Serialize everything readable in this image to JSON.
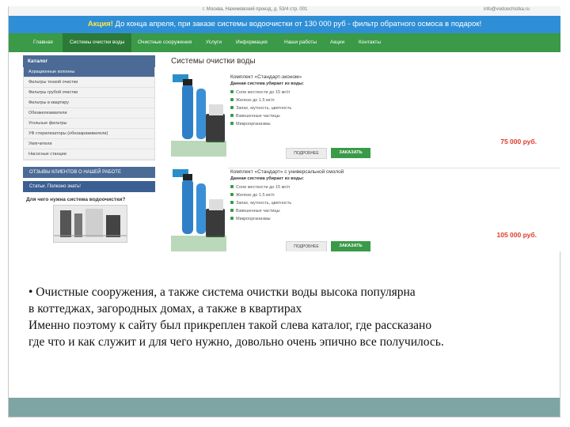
{
  "topbar": {
    "left": "г. Москва, Нахимовский проезд, д. 53/4 стр. 001",
    "right": "info@vodoochistka.ru"
  },
  "promo": {
    "highlight": "Акция!",
    "text": "До конца апреля, при заказе системы водоочистки от 130 000 руб - фильтр обратного осмоса в подарок!"
  },
  "nav": [
    "Главная",
    "Системы очистки воды",
    "Очистные сооружения",
    "Услуги",
    "Информация",
    "Наши работы",
    "Акции",
    "Контакты"
  ],
  "sidebar": {
    "title": "Каталог",
    "items": [
      "Аэрационные колонны",
      "Фильтры тонкой очистки",
      "Фильтры грубой очистки",
      "Фильтры в квартиру",
      "Обезжелезиватели",
      "Угольные фильтры",
      "УФ стерилизаторы (обеззараживатели)",
      "Умягчители",
      "Насосные станции"
    ],
    "reviews_button": "ОТЗЫВЫ КЛИЕНТОВ О НАШЕЙ РАБОТЕ",
    "article_button": "Статьи. Полезно знать!",
    "question": "Для чего нужна система водоочистки?"
  },
  "main": {
    "title": "Системы очистки воды",
    "products": [
      {
        "name": "Комплект «Стандарт-эконом»",
        "subtitle": "Данная система убирает из воды:",
        "features": [
          "Соли жесткости до 15 мг/л",
          "Железо до 1.5 мг/л",
          "Запах, мутность, цветность",
          "Взвешенные частицы",
          "Микроорганизмы"
        ],
        "price": "75 000 руб.",
        "more": "ПОДРОБНЕЕ",
        "order": "ЗАКАЗАТЬ"
      },
      {
        "name": "Комплект «Стандарт» с универсальной смолой",
        "subtitle": "Данная система убирает из воды:",
        "features": [
          "Соли жесткости до 15 мг/л",
          "Железо до 1.5 мг/л",
          "Запах, мутность, цветность",
          "Взвешенные частицы",
          "Микроорганизмы"
        ],
        "price": "105 000 руб.",
        "more": "ПОДРОБНЕЕ",
        "order": "ЗАКАЗАТЬ"
      }
    ]
  },
  "caption": [
    "• Очистные сооружения, а также система очистки воды высока популярна",
    "в коттеджах, загородных домах, а также в квартирах",
    " Именно поэтому к сайту был прикреплен такой слева каталог, где рассказано",
    "где что и как служит и для чего нужно, довольно очень эпично все получилось."
  ],
  "colors": {
    "promo": "#2f8fd6",
    "nav": "#3a9a48",
    "sidebar": "#4b6a96",
    "price": "#e03a2a",
    "band": "#7fa4a4"
  }
}
